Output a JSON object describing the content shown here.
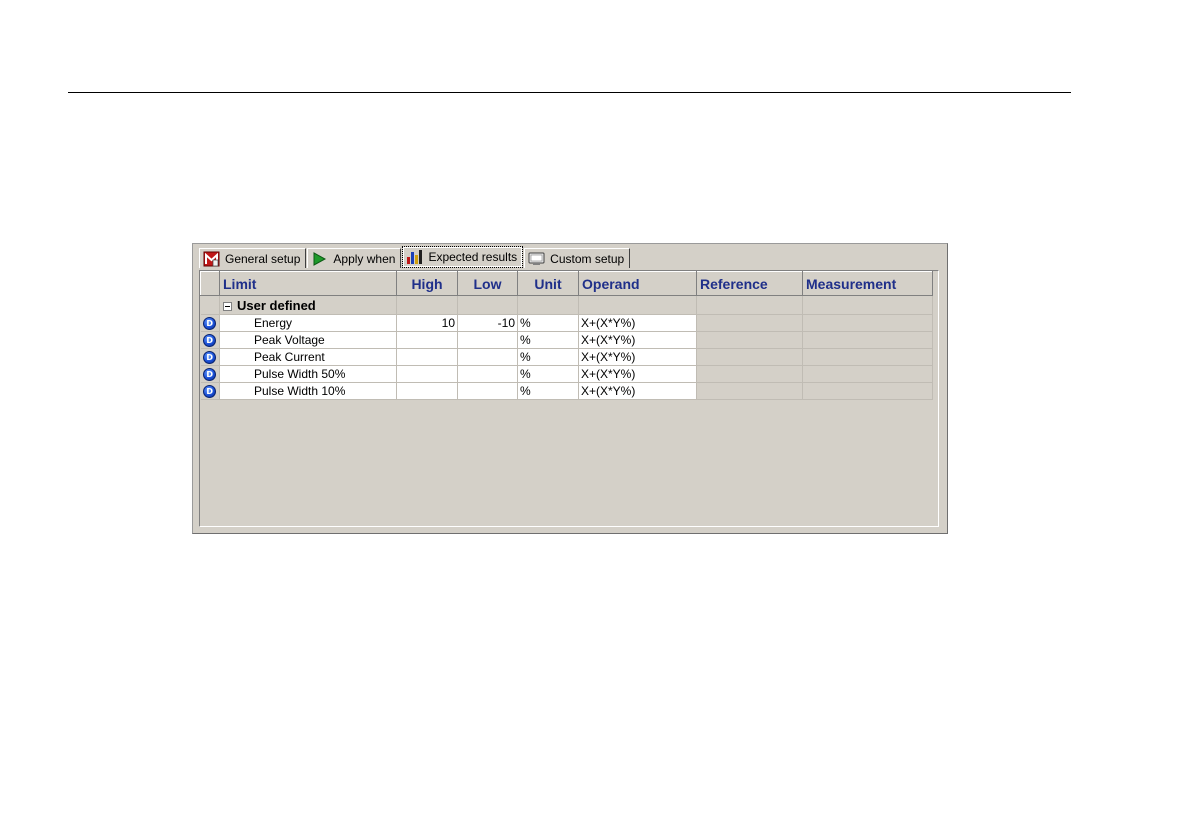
{
  "tabs": [
    {
      "label": "General setup",
      "icon": "m-icon",
      "active": false
    },
    {
      "label": "Apply when",
      "icon": "play-icon",
      "active": false
    },
    {
      "label": "Expected results",
      "icon": "bar-chart-icon",
      "active": true
    },
    {
      "label": "Custom setup",
      "icon": "monitor-icon",
      "active": false
    }
  ],
  "grid": {
    "columns": [
      "Limit",
      "High",
      "Low",
      "Unit",
      "Operand",
      "Reference",
      "Measurement"
    ],
    "group": {
      "label": "User defined",
      "expander_icon": "collapse-minus-icon"
    },
    "rows": [
      {
        "limit": "Energy",
        "high": "10",
        "low": "-10",
        "unit": "%",
        "operand": "X+(X*Y%)",
        "reference": "",
        "measurement": ""
      },
      {
        "limit": "Peak Voltage",
        "high": "",
        "low": "",
        "unit": "%",
        "operand": "X+(X*Y%)",
        "reference": "",
        "measurement": ""
      },
      {
        "limit": "Peak Current",
        "high": "",
        "low": "",
        "unit": "%",
        "operand": "X+(X*Y%)",
        "reference": "",
        "measurement": ""
      },
      {
        "limit": "Pulse Width 50%",
        "high": "",
        "low": "",
        "unit": "%",
        "operand": "X+(X*Y%)",
        "reference": "",
        "measurement": ""
      },
      {
        "limit": "Pulse Width 10%",
        "high": "",
        "low": "",
        "unit": "%",
        "operand": "X+(X*Y%)",
        "reference": "",
        "measurement": ""
      }
    ],
    "row_icon": "d-circle-icon"
  },
  "colors": {
    "panel": "#d4d0c8",
    "header_text": "#1f2f8a",
    "row_icon": "#1a4fd6"
  }
}
